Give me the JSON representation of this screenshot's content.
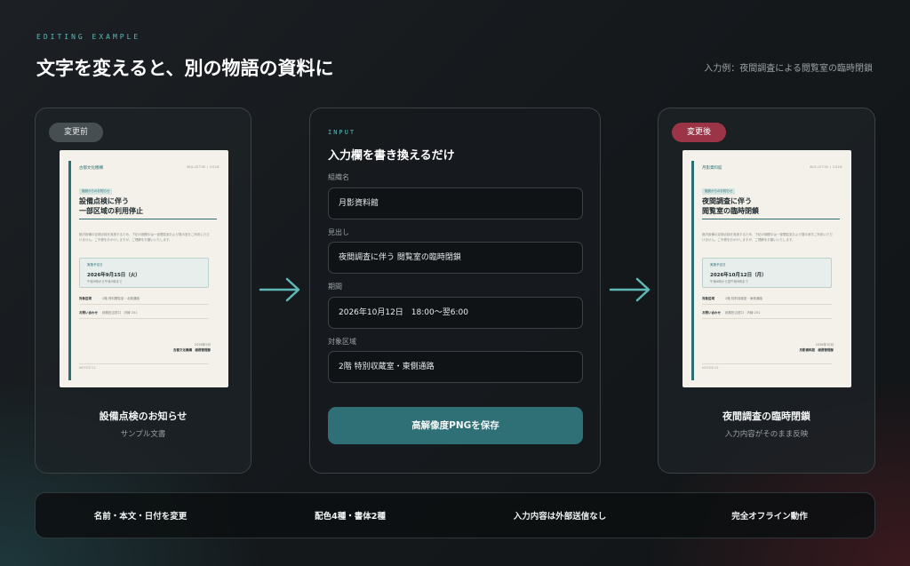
{
  "header": {
    "eyebrow": "EDITING EXAMPLE",
    "title": "文字を変えると、別の物語の資料に",
    "example_note": "入力例：夜間調査による閲覧室の臨時閉鎖"
  },
  "before": {
    "pill": "変更前",
    "caption": "設備点検のお知らせ",
    "subcaption": "サンプル文書",
    "doc": {
      "org": "古都文化機構",
      "meta": "BULLETIN / 2026",
      "tag": "施設からのお知らせ",
      "heading_line1": "設備点検に伴う",
      "heading_line2": "一部区域の利用停止",
      "body": "館内設備の定期点検を実施するため、下記の期間中は一部閲覧室および展示室をご利用いただけません。ご不便をおかけしますが、ご理解をお願いいたします。",
      "box_label": "実施予定日",
      "box_date": "2026年9月15日（火）",
      "box_sub": "午前9時から午後5時まで",
      "row1_label": "対象区域",
      "row1_value": "2階 資料閲覧室・北側通路",
      "row2_label": "お問い合わせ",
      "row2_value": "総務担当窓口　内線 201",
      "sign_date": "2026年9月",
      "sign_org": "古都文化機構　総務管理部",
      "footer": "NOTICE 01"
    }
  },
  "input": {
    "eyebrow": "INPUT",
    "title": "入力欄を書き換えるだけ",
    "fields": [
      {
        "label": "組織名",
        "value": "月影資料館"
      },
      {
        "label": "見出し",
        "value": "夜間調査に伴う 閲覧室の臨時閉鎖"
      },
      {
        "label": "期間",
        "value": "2026年10月12日　18:00〜翌6:00"
      },
      {
        "label": "対象区域",
        "value": "2階 特別収蔵室・東側通路"
      }
    ],
    "save_label": "高解像度PNGを保存"
  },
  "after": {
    "pill": "変更後",
    "caption": "夜間調査の臨時閉鎖",
    "subcaption": "入力内容がそのまま反映",
    "doc": {
      "org": "月影資料館",
      "meta": "BULLETIN / 2026",
      "tag": "施設からのお知らせ",
      "heading_line1": "夜間調査に伴う",
      "heading_line2": "閲覧室の臨時閉鎖",
      "body": "館内設備の定期点検を実施するため、下記の期間中は一部閲覧室および展示室をご利用いただけません。ご不便をおかけしますが、ご理解をお願いいたします。",
      "box_label": "実施予定日",
      "box_date": "2026年10月12日（月）",
      "box_sub": "午後6時から翌午前6時まで",
      "row1_label": "対象区域",
      "row1_value": "2階 特別収蔵室・東側通路",
      "row2_label": "お問い合わせ",
      "row2_value": "総務担当窓口　内線 201",
      "sign_date": "2026年10月",
      "sign_org": "月影資料館　総務管理部",
      "footer": "NOTICE 01"
    }
  },
  "features": [
    "名前・本文・日付を変更",
    "配色4種・書体2種",
    "入力内容は外部送信なし",
    "完全オフライン動作"
  ],
  "colors": {
    "accent": "#5fb8b8",
    "button": "#2f6f76",
    "after_pill": "#9b3446",
    "doc_accent": "#2d6e73"
  }
}
